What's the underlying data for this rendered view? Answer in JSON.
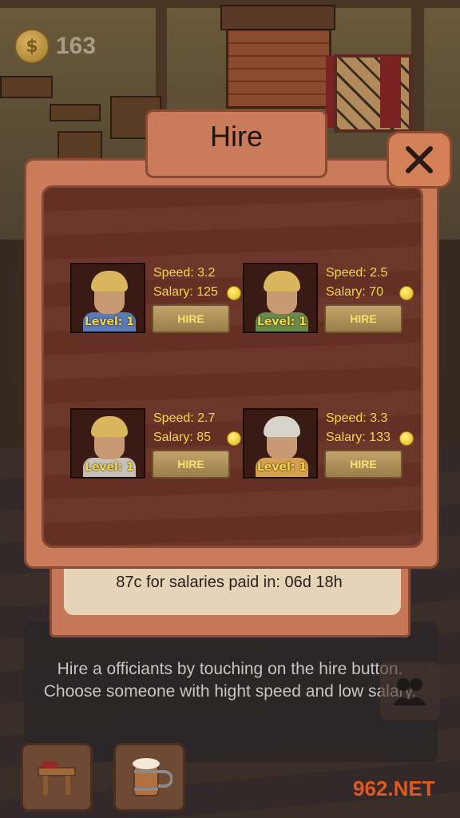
{
  "coins": {
    "icon": "coin-icon",
    "count": "163"
  },
  "dialog": {
    "title": "Hire",
    "close_icon": "close-icon",
    "salary_notice": "87c for salaries paid in: 06d 18h"
  },
  "candidates": [
    {
      "speed": "Speed: 3.2",
      "salary": "Salary: 125",
      "level": "Level: 1",
      "hire_label": "HIRE",
      "hair_color": "#d9b65e",
      "shirt_color": "#5a7bb5"
    },
    {
      "speed": "Speed: 2.5",
      "salary": "Salary: 70",
      "level": "Level: 1",
      "hire_label": "HIRE",
      "hair_color": "#d9b65e",
      "shirt_color": "#6a8a4a"
    },
    {
      "speed": "Speed: 2.7",
      "salary": "Salary: 85",
      "level": "Level: 1",
      "hire_label": "HIRE",
      "hair_color": "#d9b65e",
      "shirt_color": "#c7c2b8"
    },
    {
      "speed": "Speed: 3.3",
      "salary": "Salary: 133",
      "level": "Level: 1",
      "hire_label": "HIRE",
      "hair_color": "#d8d4cc",
      "shirt_color": "#d6a050"
    }
  ],
  "hint": {
    "text": "Hire a officiants by touching on the hire button. Choose someone with hight speed and low salary."
  },
  "bottom_bar": [
    {
      "icon": "table-icon"
    },
    {
      "icon": "beer-mug-icon"
    }
  ],
  "side_button": {
    "icon": "people-icon"
  },
  "watermark": "962.NET"
}
